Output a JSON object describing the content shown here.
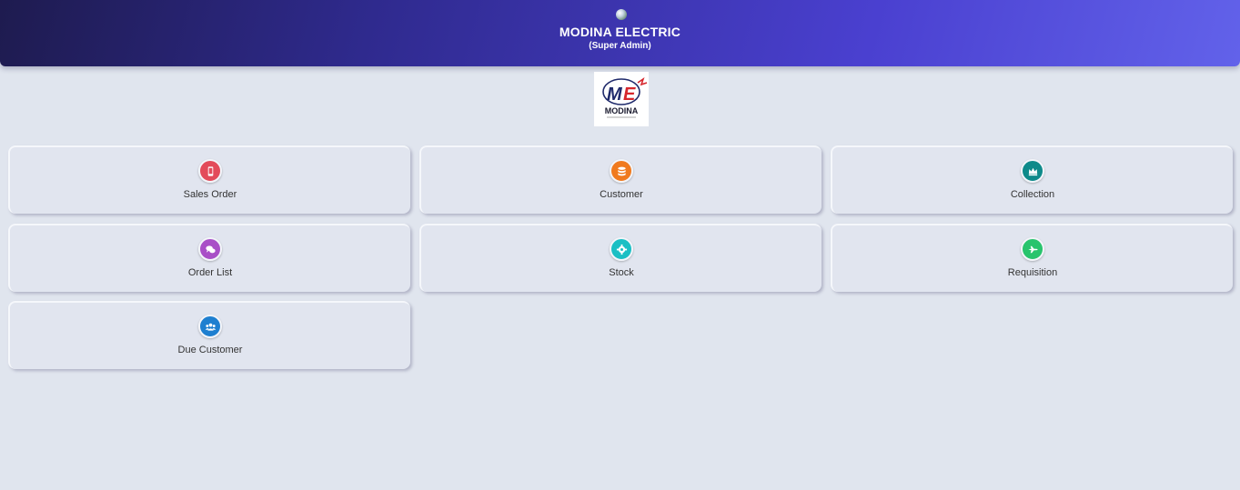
{
  "header": {
    "title": "MODINA ELECTRIC",
    "subtitle": "(Super Admin)"
  },
  "logo": {
    "text": "MODINA",
    "monogram": "ME",
    "colors": {
      "navy": "#1f2a6b",
      "red": "#d6262c"
    }
  },
  "tiles": [
    {
      "label": "Sales Order",
      "icon": "mobile-icon",
      "color": "#e34b5a"
    },
    {
      "label": "Customer",
      "icon": "database-icon",
      "color": "#f07a1e"
    },
    {
      "label": "Collection",
      "icon": "crown-icon",
      "color": "#0e8a8a"
    },
    {
      "label": "Order List",
      "icon": "chat-bubbles-icon",
      "color": "#a94fc7"
    },
    {
      "label": "Stock",
      "icon": "gear-icon",
      "color": "#1bbfc4"
    },
    {
      "label": "Requisition",
      "icon": "plane-icon",
      "color": "#28c46d"
    },
    {
      "label": "Due Customer",
      "icon": "users-icon",
      "color": "#1e7fd0"
    }
  ]
}
